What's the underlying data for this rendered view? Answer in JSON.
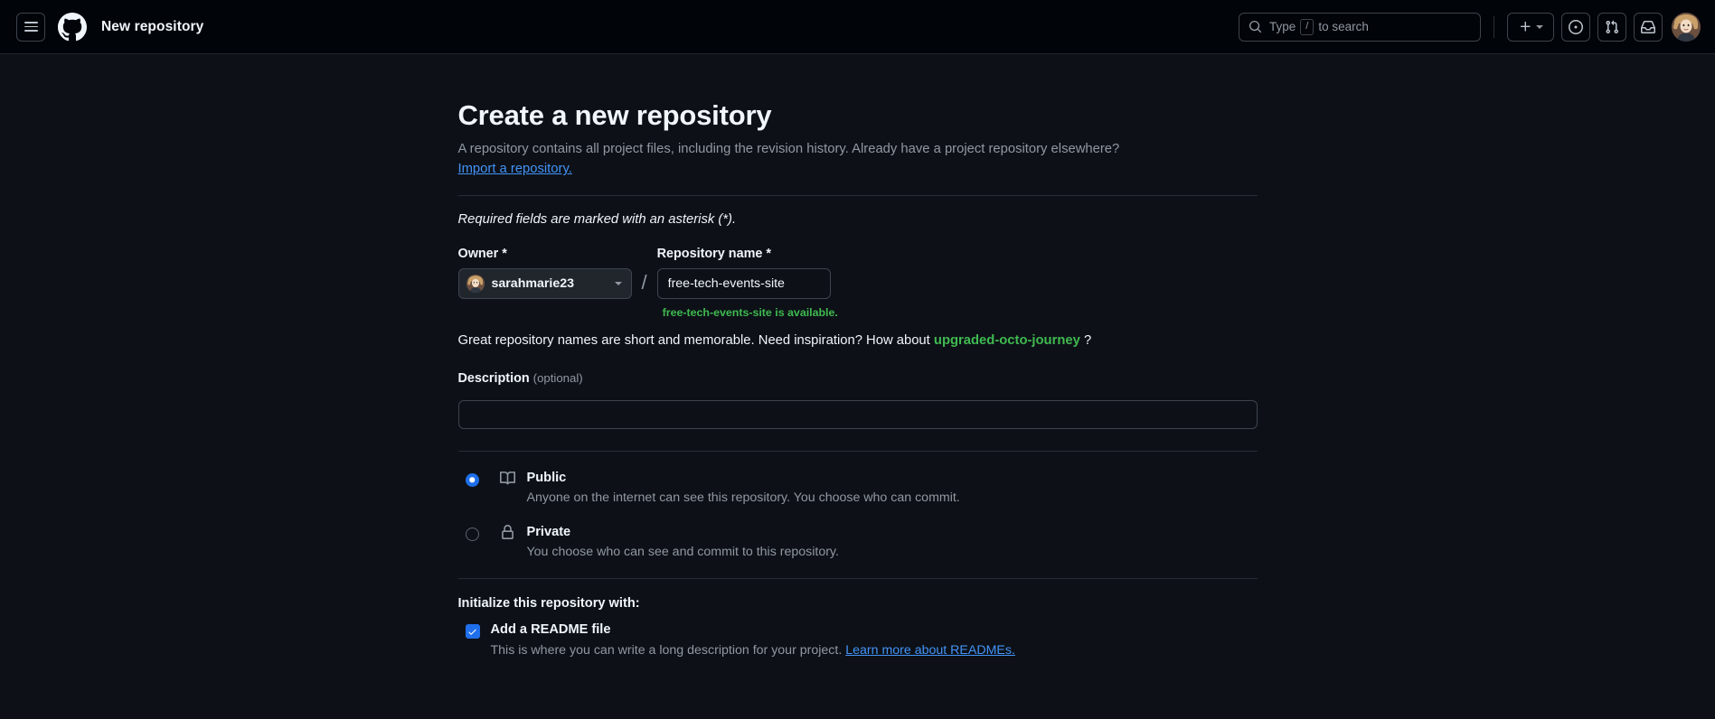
{
  "header": {
    "menu_icon": "hamburger-menu-icon",
    "logo_icon": "github-logo-icon",
    "title": "New repository",
    "search": {
      "icon": "search-icon",
      "prefix": "Type",
      "key": "/",
      "suffix": "to search"
    },
    "create_icon": "plus-icon",
    "issues_icon": "issue-opened-icon",
    "pull_requests_icon": "git-pull-request-icon",
    "inbox_icon": "inbox-icon",
    "avatar_name": "user-avatar"
  },
  "main": {
    "title": "Create a new repository",
    "subtitle": "A repository contains all project files, including the revision history. Already have a project repository elsewhere?",
    "import_link": "Import a repository.",
    "required_note": "Required fields are marked with an asterisk (*).",
    "owner": {
      "label": "Owner *",
      "value": "sarahmarie23",
      "caret_icon": "chevron-down-icon"
    },
    "separator": "/",
    "repository": {
      "label": "Repository name *",
      "value": "free-tech-events-site",
      "placeholder": "",
      "availability_icon": "check-circle-icon",
      "availability_text": "free-tech-events-site is available."
    },
    "suggestion": {
      "prefix": "Great repository names are short and memorable. Need inspiration? How about",
      "name": "upgraded-octo-journey",
      "suffix": "?"
    },
    "description": {
      "label": "Description",
      "optional": "(optional)",
      "value": "",
      "placeholder": ""
    },
    "visibility": [
      {
        "id": "public",
        "icon": "repo-book-icon",
        "title": "Public",
        "description": "Anyone on the internet can see this repository. You choose who can commit.",
        "selected": true
      },
      {
        "id": "private",
        "icon": "lock-icon",
        "title": "Private",
        "description": "You choose who can see and commit to this repository.",
        "selected": false
      }
    ],
    "initialize": {
      "heading": "Initialize this repository with:",
      "readme": {
        "label": "Add a README file",
        "checked": true,
        "description": "This is where you can write a long description for your project.",
        "link": "Learn more about READMEs."
      }
    }
  },
  "colors": {
    "accent_blue": "#1f6feb",
    "link_blue": "#4493f8",
    "success_green": "#3fb950",
    "background": "#0d1117",
    "header_bg": "#010409"
  }
}
